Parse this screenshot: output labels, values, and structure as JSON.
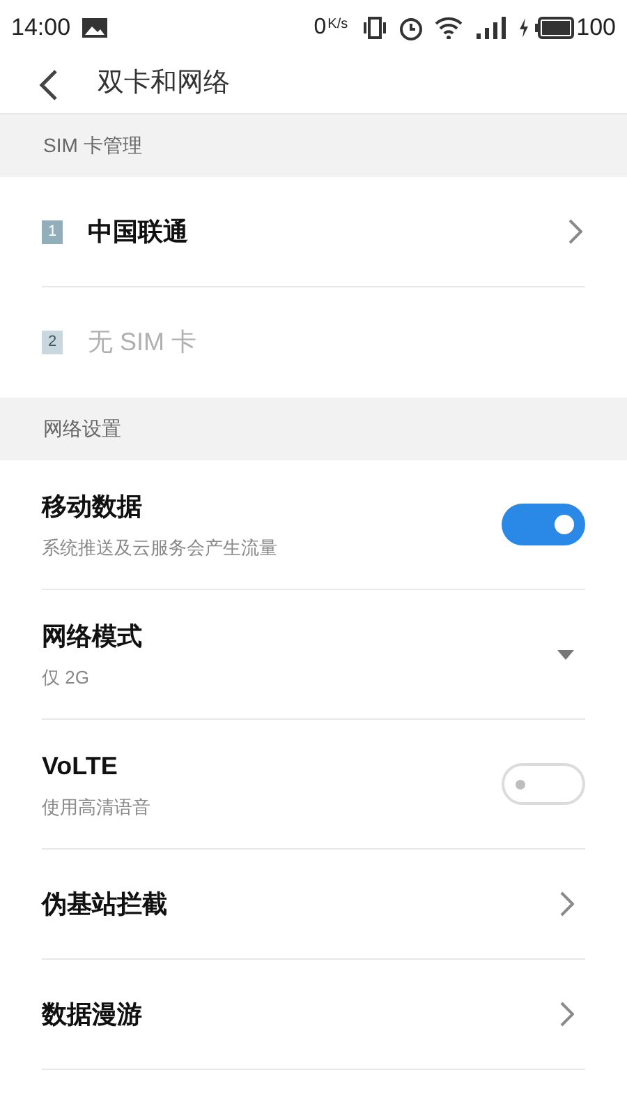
{
  "status_bar": {
    "time": "14:00",
    "speed": "0",
    "speed_unit": "K/s",
    "battery": "100"
  },
  "header": {
    "title": "双卡和网络"
  },
  "sections": [
    {
      "title": "SIM 卡管理",
      "items": [
        {
          "kind": "sim",
          "slot": "1",
          "label": "中国联通",
          "disabled": false
        },
        {
          "kind": "sim",
          "slot": "2",
          "label": "无 SIM 卡",
          "disabled": true
        }
      ]
    },
    {
      "title": "网络设置",
      "items": [
        {
          "kind": "toggle",
          "label": "移动数据",
          "subtitle": "系统推送及云服务会产生流量",
          "on": true
        },
        {
          "kind": "dropdown",
          "label": "网络模式",
          "subtitle": "仅 2G"
        },
        {
          "kind": "toggle",
          "label": "VoLTE",
          "subtitle": "使用高清语音",
          "on": false
        },
        {
          "kind": "link",
          "label": "伪基站拦截"
        },
        {
          "kind": "link",
          "label": "数据漫游"
        }
      ]
    }
  ]
}
